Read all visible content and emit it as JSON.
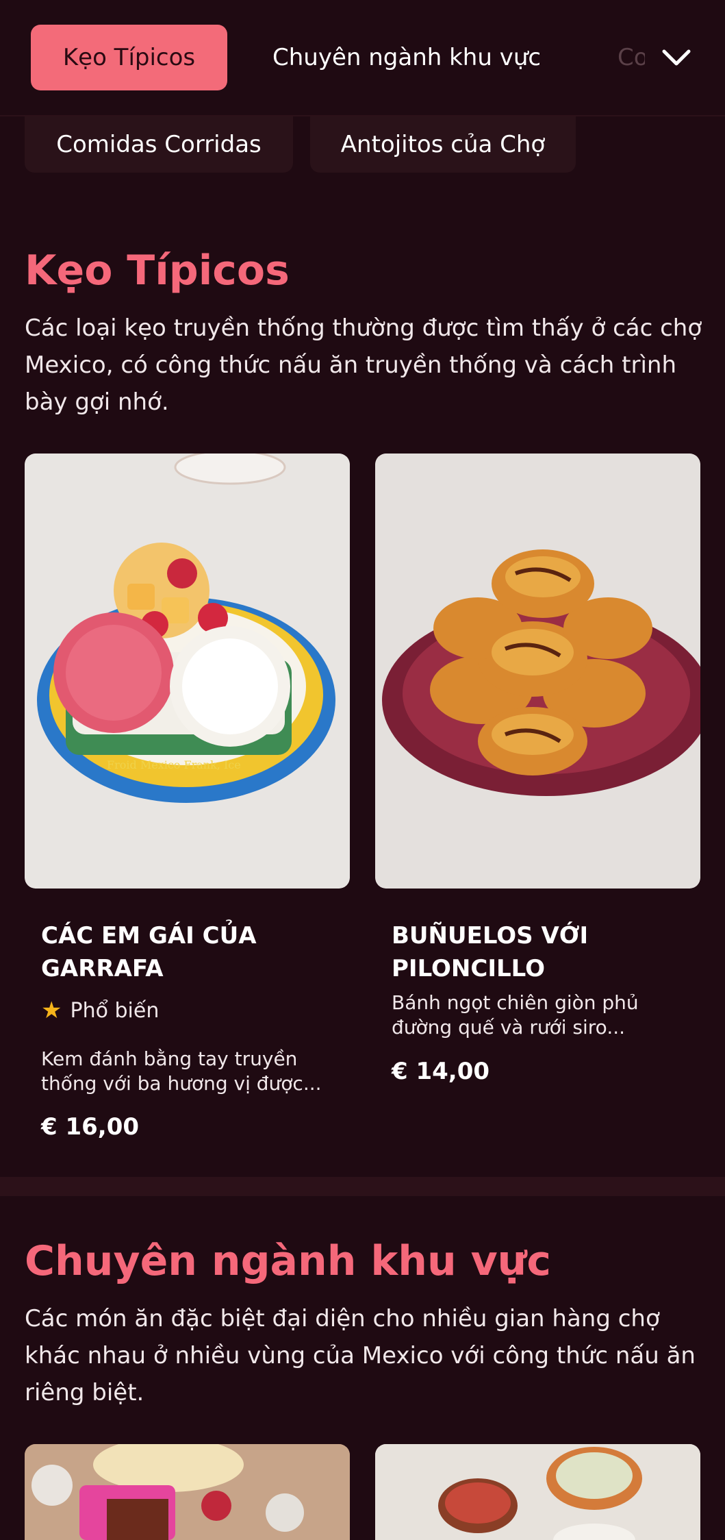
{
  "nav": {
    "tabs": [
      "Kẹo Típicos",
      "Chuyên ngành khu vực",
      "Co"
    ],
    "active_tab": "Kẹo Típicos",
    "chips": [
      "Comidas Corridas",
      "Antojitos của Chợ"
    ],
    "expand_icon": "chevron-down-icon"
  },
  "sections": [
    {
      "title": "Kẹo Típicos",
      "desc_lines": [
        "Các loại kẹo truyền thống thường được tìm thấy ở các chợ",
        "Mexico, có công thức nấu ăn truyền thống và cách trình",
        "bày gợi nhớ."
      ],
      "cards": [
        {
          "title_lines": [
            "CÁC EM GÁI CỦA",
            "GARRAFA"
          ],
          "badge": "Phổ biến",
          "desc_lines": [
            "Kem đánh bằng tay truyền",
            "thống với ba hương vị được..."
          ],
          "price": "€ 16,00",
          "image_text": "Froid Mexico Frank, Ice"
        },
        {
          "title_lines": [
            "BUÑUELOS VỚI",
            "PILONCILLO"
          ],
          "desc_lines": [
            "Bánh ngọt chiên giòn phủ",
            "đường quế và rưới siro..."
          ],
          "price": "€ 14,00"
        }
      ]
    },
    {
      "title": "Chuyên ngành khu vực",
      "desc_lines": [
        "Các món ăn đặc biệt đại diện cho nhiều gian hàng chợ",
        "khác nhau ở nhiều vùng của Mexico với công thức nấu ăn",
        "riêng biệt."
      ]
    }
  ],
  "colors": {
    "background": "#1f0a12",
    "accent": "#f36b79",
    "title": "#f5687a",
    "star": "#f6b41b"
  }
}
